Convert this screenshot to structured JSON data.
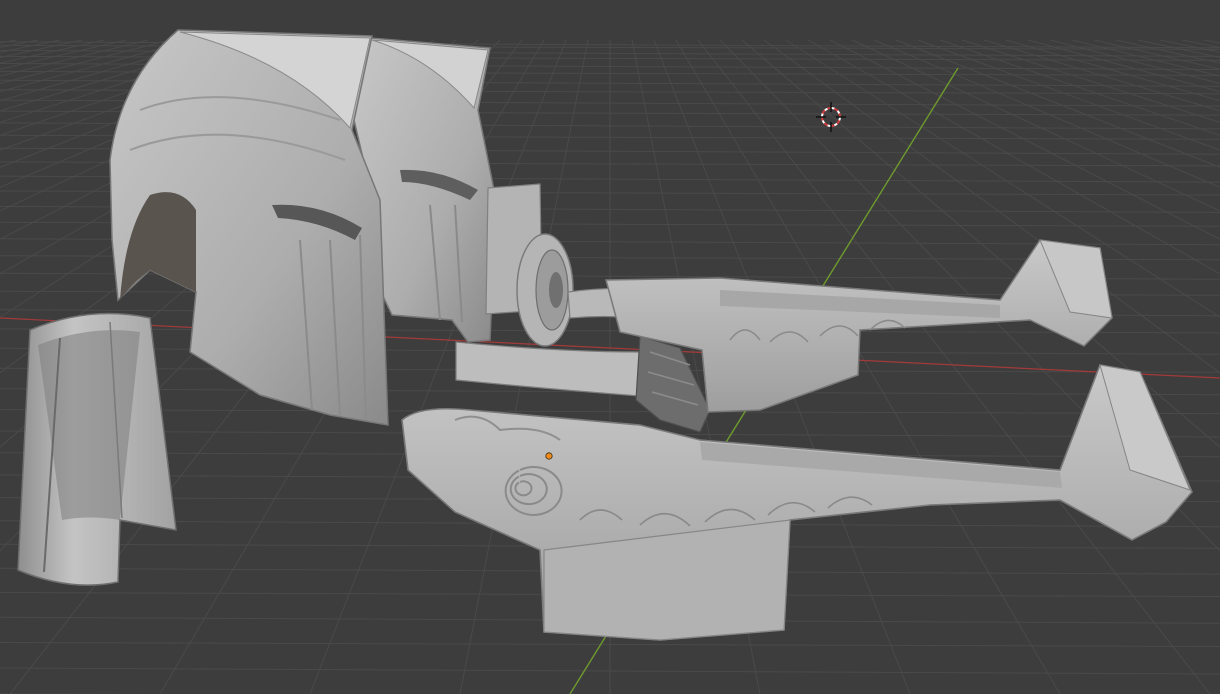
{
  "viewport": {
    "background_color": "#3d3d3d",
    "grid_line_color": "#4a4a4a",
    "x_axis_color": "#a33a3a",
    "y_axis_color": "#6e9a2e",
    "mesh_color": "#b8b8b8",
    "mesh_shadow_color": "#8d8d8d",
    "cursor_icon": "3d-cursor-icon",
    "origin_icon": "object-origin-icon",
    "origin_color": "#f08a1a"
  }
}
